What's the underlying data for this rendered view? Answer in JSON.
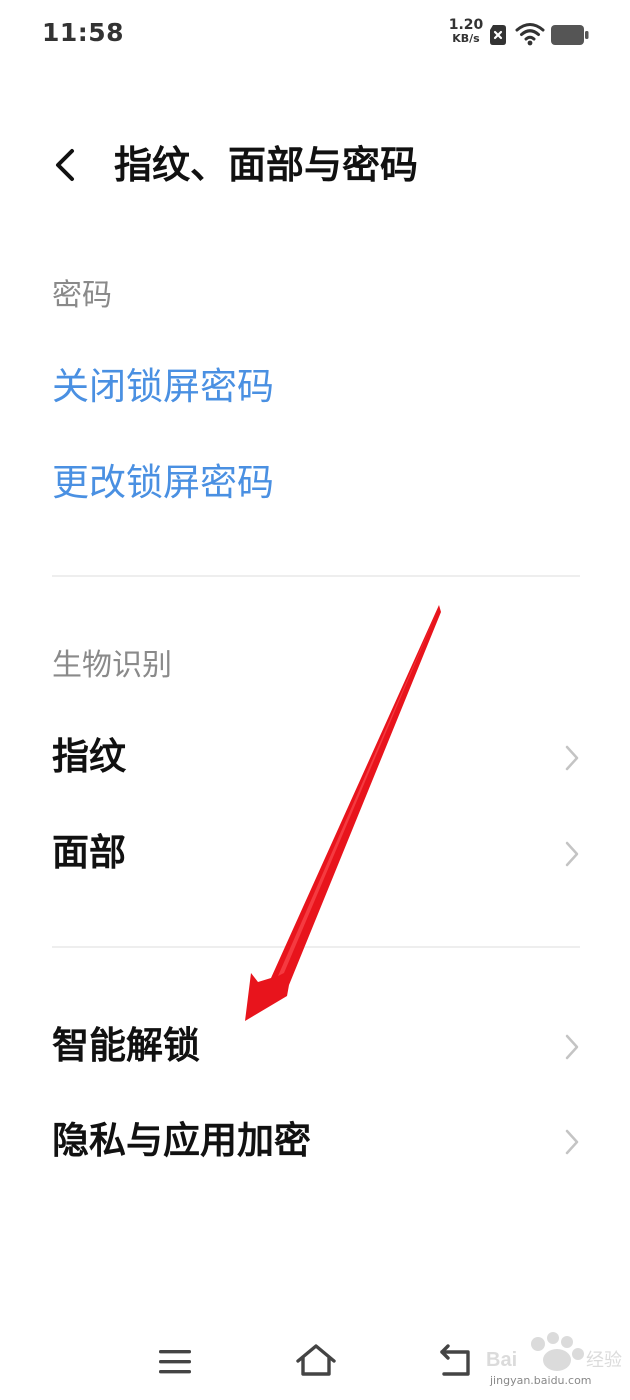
{
  "status_bar": {
    "time": "11:58",
    "net_speed_value": "1.20",
    "net_speed_unit": "KB/s"
  },
  "header": {
    "title": "指纹、面部与密码"
  },
  "sections": {
    "password": {
      "header": "密码",
      "items": [
        "关闭锁屏密码",
        "更改锁屏密码"
      ]
    },
    "biometrics": {
      "header": "生物识别",
      "items": [
        "指纹",
        "面部"
      ]
    },
    "other": {
      "items": [
        "智能解锁",
        "隐私与应用加密"
      ]
    }
  },
  "colors": {
    "link": "#4a90e2",
    "section_header": "#8a8a8a",
    "annotation_arrow": "#e8141c"
  },
  "watermark": {
    "text": "jingyan.baidu.com"
  }
}
